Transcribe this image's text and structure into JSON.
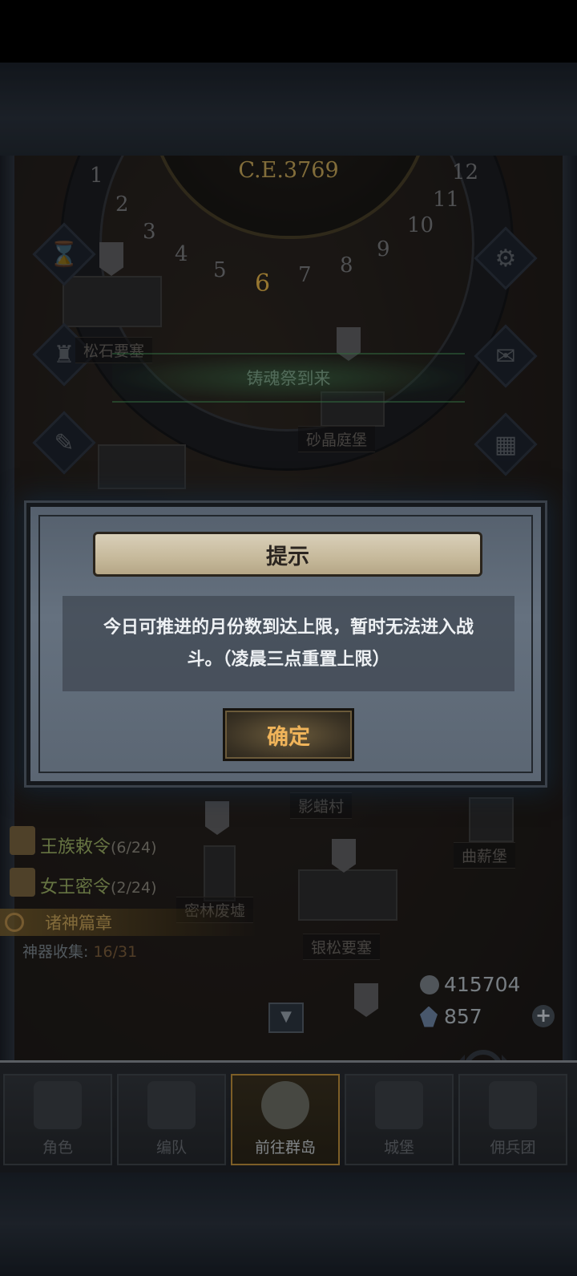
{
  "map": {
    "era": "C.E.3769",
    "months": [
      "1",
      "2",
      "3",
      "4",
      "5",
      "6",
      "7",
      "8",
      "9",
      "10",
      "11",
      "12"
    ],
    "current_month": "6",
    "festival_banner": "铸魂祭到来",
    "locations": [
      "松石要塞",
      "砂晶庭堡",
      "影蜡村",
      "曲薪堡",
      "密林废墟",
      "银松要塞"
    ]
  },
  "quests": [
    {
      "label": "王族敕令",
      "count": "(6/24)"
    },
    {
      "label": "女王密令",
      "count": "(2/24)"
    }
  ],
  "search": {
    "label": "诸神篇章"
  },
  "artifact": {
    "label": "神器收集:",
    "value": "16/31"
  },
  "resources": {
    "coins": "415704",
    "gems": "857",
    "plus": "+"
  },
  "bottom_nav": [
    {
      "label": "角色",
      "active": false
    },
    {
      "label": "编队",
      "active": false
    },
    {
      "label": "前往群岛",
      "active": true
    },
    {
      "label": "城堡",
      "active": false
    },
    {
      "label": "佣兵团",
      "active": false
    }
  ],
  "dialog": {
    "title": "提示",
    "message": "今日可推进的月份数到达上限，暂时无法进入战斗。（凌晨三点重置上限）",
    "confirm": "确定"
  },
  "colors": {
    "accent_gold": "#e7b64a",
    "quest_green": "#9db266",
    "dialog_bg": "#5b6673"
  }
}
